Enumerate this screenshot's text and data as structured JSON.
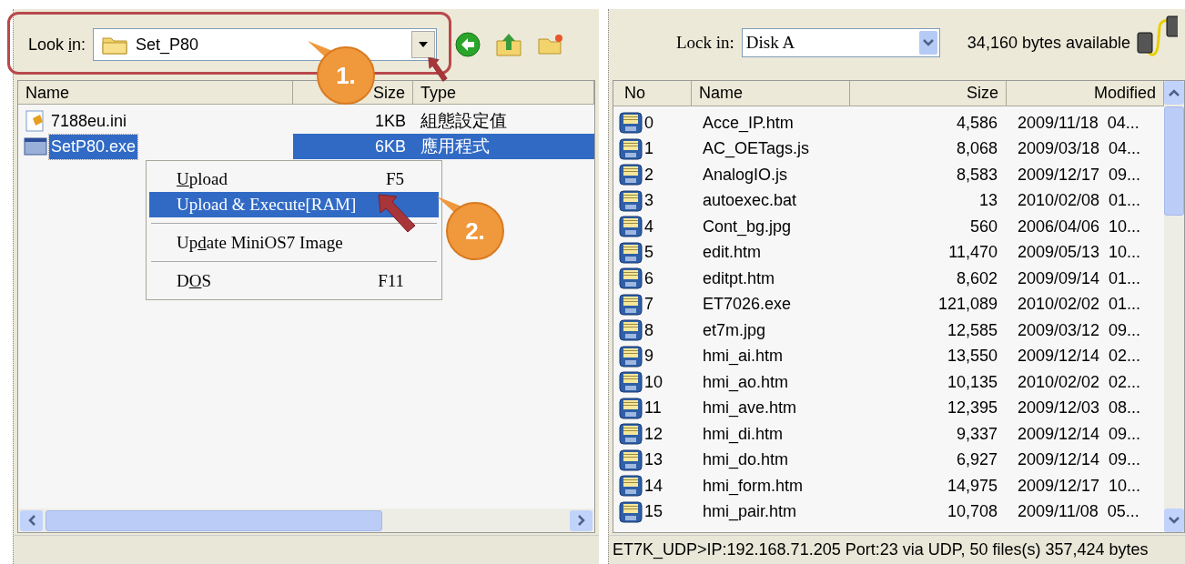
{
  "left_pane": {
    "look_in": {
      "label_parts": [
        {
          "text": "Look ",
          "underline": false
        },
        {
          "text": "i",
          "underline": true
        },
        {
          "text": "n:",
          "underline": false
        }
      ],
      "value": "Set_P80"
    },
    "columns": [
      "Name",
      "Size",
      "Type"
    ],
    "rows": [
      {
        "name": "7188eu.ini",
        "size": "1KB",
        "type": "組態設定值",
        "kind": "config",
        "selected": false
      },
      {
        "name": "SetP80.exe",
        "size": "6KB",
        "type": "應用程式",
        "kind": "app",
        "selected": true
      }
    ]
  },
  "context_menu": {
    "items": [
      {
        "kind": "item",
        "label_parts": [
          {
            "text": "U",
            "underline": true
          },
          {
            "text": "pload",
            "underline": false
          }
        ],
        "shortcut": "F5",
        "selected": false
      },
      {
        "kind": "item",
        "label_parts": [
          {
            "text": "Upload & Execute[RAM]",
            "underline": false
          }
        ],
        "selected": true
      },
      {
        "kind": "separator"
      },
      {
        "kind": "item",
        "label_parts": [
          {
            "text": "Up",
            "underline": false
          },
          {
            "text": "d",
            "underline": true
          },
          {
            "text": "ate MiniOS7 Image",
            "underline": false
          }
        ],
        "selected": false
      },
      {
        "kind": "separator"
      },
      {
        "kind": "item",
        "label_parts": [
          {
            "text": "D",
            "underline": false
          },
          {
            "text": "O",
            "underline": true
          },
          {
            "text": "S",
            "underline": false
          }
        ],
        "shortcut": "F11",
        "selected": false
      }
    ]
  },
  "right_pane": {
    "look_in": {
      "label": "Lock in:",
      "value": "Disk A"
    },
    "free_space": "34,160 bytes available",
    "columns": [
      "No",
      "Name",
      "Size",
      "Modified"
    ],
    "rows": [
      {
        "no": "0",
        "name": "Acce_IP.htm",
        "size": "4,586",
        "modified": "2009/11/18  04..."
      },
      {
        "no": "1",
        "name": "AC_OETags.js",
        "size": "8,068",
        "modified": "2009/03/18  04..."
      },
      {
        "no": "2",
        "name": "AnalogIO.js",
        "size": "8,583",
        "modified": "2009/12/17  09..."
      },
      {
        "no": "3",
        "name": "autoexec.bat",
        "size": "13",
        "modified": "2010/02/08  01..."
      },
      {
        "no": "4",
        "name": "Cont_bg.jpg",
        "size": "560",
        "modified": "2006/04/06  10..."
      },
      {
        "no": "5",
        "name": "edit.htm",
        "size": "11,470",
        "modified": "2009/05/13  10..."
      },
      {
        "no": "6",
        "name": "editpt.htm",
        "size": "8,602",
        "modified": "2009/09/14  01..."
      },
      {
        "no": "7",
        "name": "ET7026.exe",
        "size": "121,089",
        "modified": "2010/02/02  01..."
      },
      {
        "no": "8",
        "name": "et7m.jpg",
        "size": "12,585",
        "modified": "2009/03/12  09..."
      },
      {
        "no": "9",
        "name": "hmi_ai.htm",
        "size": "13,550",
        "modified": "2009/12/14  02..."
      },
      {
        "no": "10",
        "name": "hmi_ao.htm",
        "size": "10,135",
        "modified": "2010/02/02  02..."
      },
      {
        "no": "11",
        "name": "hmi_ave.htm",
        "size": "12,395",
        "modified": "2009/12/03  08..."
      },
      {
        "no": "12",
        "name": "hmi_di.htm",
        "size": "9,337",
        "modified": "2009/12/14  09..."
      },
      {
        "no": "13",
        "name": "hmi_do.htm",
        "size": "6,927",
        "modified": "2009/12/14  09..."
      },
      {
        "no": "14",
        "name": "hmi_form.htm",
        "size": "14,975",
        "modified": "2009/12/17  10..."
      },
      {
        "no": "15",
        "name": "hmi_pair.htm",
        "size": "10,708",
        "modified": "2009/11/08  05..."
      }
    ],
    "status": "ET7K_UDP>IP:192.168.71.205 Port:23 via UDP, 50 files(s) 357,424 bytes"
  },
  "callouts": [
    {
      "label": "1."
    },
    {
      "label": "2."
    }
  ]
}
